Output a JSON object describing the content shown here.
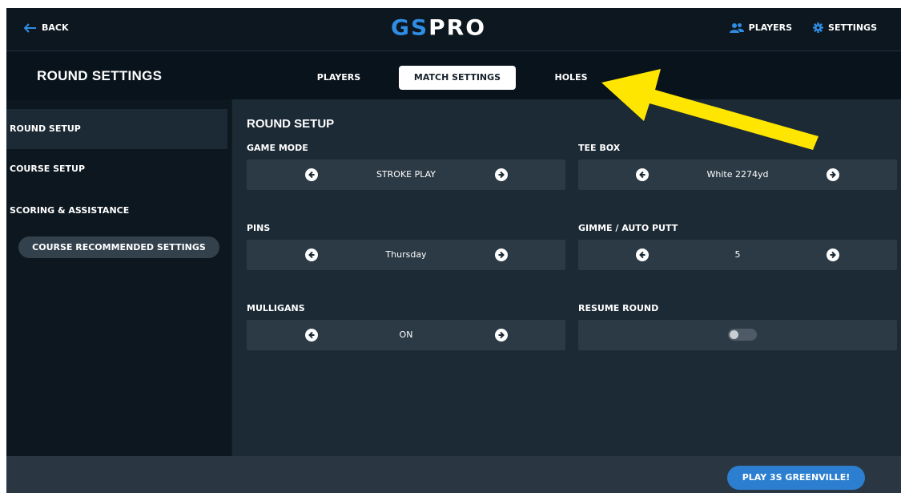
{
  "topbar": {
    "back_label": "BACK",
    "logo": {
      "left": "GS",
      "right": "PRO"
    },
    "players_label": "PLAYERS",
    "settings_label": "SETTINGS"
  },
  "header": {
    "title": "ROUND SETTINGS",
    "tabs": [
      {
        "label": "PLAYERS",
        "active": false
      },
      {
        "label": "MATCH SETTINGS",
        "active": true
      },
      {
        "label": "HOLES",
        "active": false
      }
    ]
  },
  "sidebar": {
    "items": [
      {
        "label": "ROUND SETUP",
        "active": true
      },
      {
        "label": "COURSE SETUP",
        "active": false
      },
      {
        "label": "SCORING & ASSISTANCE",
        "active": false
      }
    ],
    "recommended_button": "COURSE RECOMMENDED SETTINGS"
  },
  "main": {
    "section_title": "ROUND SETUP",
    "settings": {
      "game_mode": {
        "label": "GAME MODE",
        "value": "STROKE PLAY"
      },
      "tee_box": {
        "label": "TEE BOX",
        "value": "White 2274yd"
      },
      "pins": {
        "label": "PINS",
        "value": "Thursday"
      },
      "gimme": {
        "label": "GIMME / AUTO PUTT",
        "value": "5"
      },
      "mulligans": {
        "label": "MULLIGANS",
        "value": "ON"
      },
      "resume_round": {
        "label": "RESUME ROUND",
        "enabled": false
      }
    }
  },
  "footer": {
    "play_button": "PLAY 3S GREENVILLE!"
  },
  "colors": {
    "accent_blue": "#2f8de4",
    "play_button": "#2c7fd0",
    "annotation_arrow": "#ffe600",
    "background": "#0f1a23",
    "panel": "#1c2a35"
  },
  "icons": [
    "arrow-left-icon",
    "users-icon",
    "gear-icon",
    "circle-arrow-left-icon",
    "circle-arrow-right-icon"
  ]
}
